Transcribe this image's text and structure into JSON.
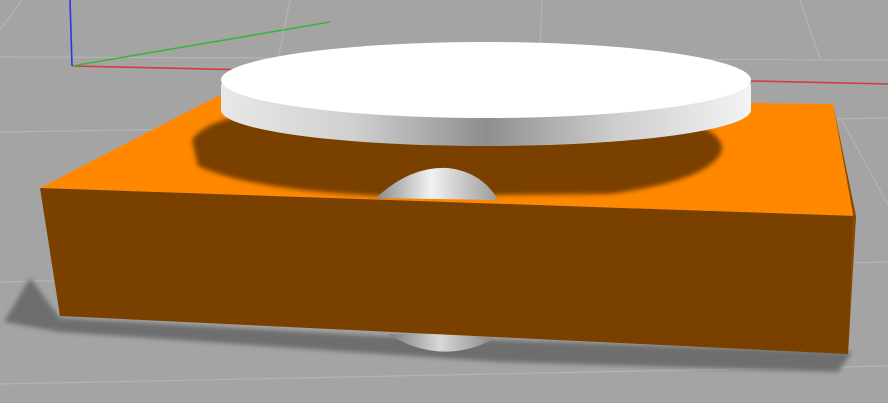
{
  "viewport": {
    "background_color": "#a4a4a4",
    "grid_color": "#b4b4b4",
    "axes": {
      "x_color": "#d23c3c",
      "y_color": "#3cb43c",
      "z_color": "#3232dc"
    }
  },
  "scene": {
    "models": [
      {
        "name": "chassis-box",
        "shape": "box",
        "top_color": "#ff8800",
        "front_color": "#7a4000",
        "shadow_color": "#6e6e6e"
      },
      {
        "name": "top-plate",
        "shape": "cylinder",
        "top_color": "#ffffff",
        "side_color_light": "#f2f2f2",
        "side_color_dark": "#8a8a8a"
      },
      {
        "name": "caster-wheel-front",
        "shape": "sphere",
        "color": "#c8c8c8"
      },
      {
        "name": "caster-wheel-rear",
        "shape": "sphere",
        "color": "#c8c8c8"
      }
    ]
  }
}
